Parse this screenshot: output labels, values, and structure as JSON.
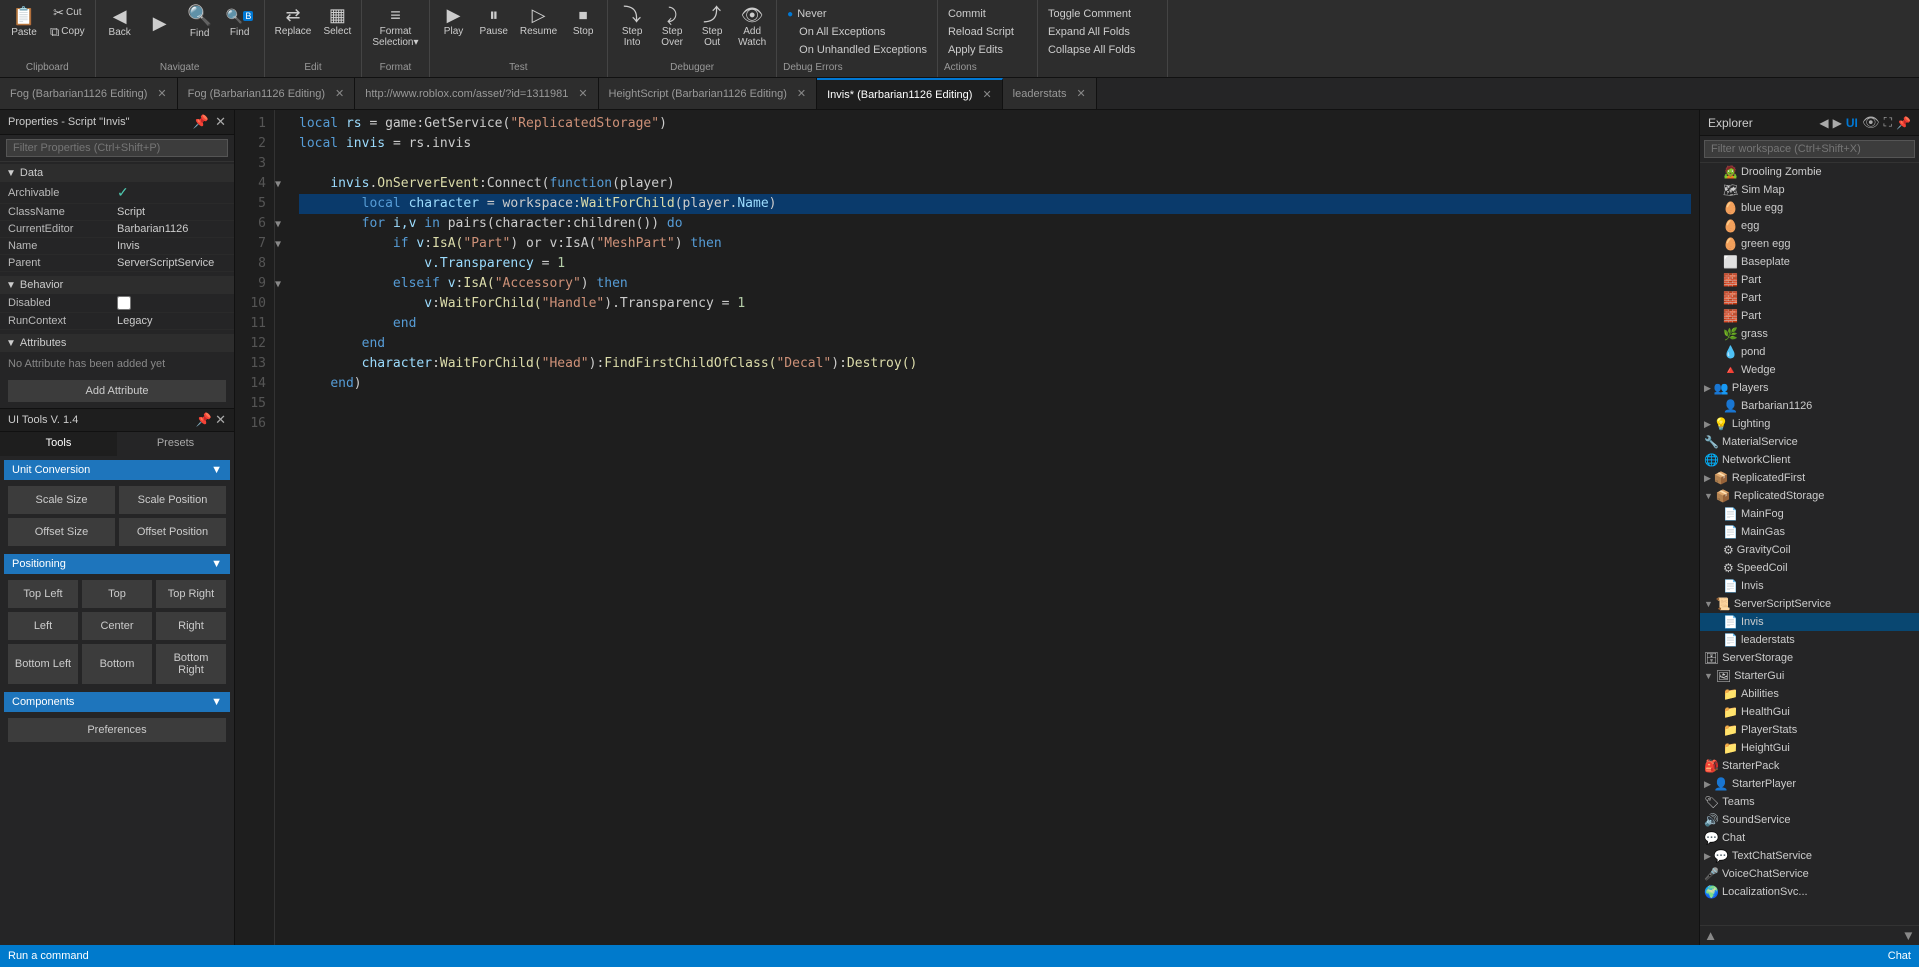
{
  "toolbar": {
    "groups": [
      {
        "label": "Clipboard",
        "buttons": [
          {
            "id": "paste",
            "icon": "📋",
            "label": "Paste"
          },
          {
            "id": "cut",
            "icon": "✂",
            "label": "Cut"
          },
          {
            "id": "copy",
            "icon": "⧉",
            "label": "Copy"
          }
        ]
      },
      {
        "label": "Navigate",
        "buttons": [
          {
            "id": "back",
            "icon": "←",
            "label": "Back"
          },
          {
            "id": "forward",
            "icon": "→",
            "label": ""
          },
          {
            "id": "find",
            "icon": "🔍",
            "label": "Find"
          },
          {
            "id": "find2",
            "icon": "🔍",
            "label": "Find"
          }
        ]
      },
      {
        "label": "Edit",
        "buttons": [
          {
            "id": "replace",
            "icon": "⇄",
            "label": "Replace"
          },
          {
            "id": "select",
            "icon": "▦",
            "label": "Select"
          }
        ]
      },
      {
        "label": "Format",
        "buttons": [
          {
            "id": "format",
            "icon": "≡",
            "label": "Format Selection▾"
          }
        ]
      },
      {
        "label": "Test",
        "buttons": [
          {
            "id": "play",
            "icon": "▶",
            "label": "Play"
          },
          {
            "id": "pause",
            "icon": "⏸",
            "label": "Pause"
          },
          {
            "id": "resume",
            "icon": "▷",
            "label": "Resume"
          },
          {
            "id": "stop",
            "icon": "⏹",
            "label": "Stop"
          }
        ]
      },
      {
        "label": "Debugger",
        "buttons": [
          {
            "id": "stepinto",
            "icon": "⤵",
            "label": "Step Into"
          },
          {
            "id": "stepover",
            "icon": "⤸",
            "label": "Step Over"
          },
          {
            "id": "stepout",
            "icon": "⤴",
            "label": "Step Out"
          },
          {
            "id": "addwatch",
            "icon": "👁",
            "label": "Add Watch"
          }
        ]
      }
    ],
    "menus": {
      "debug_errors": {
        "items": [
          "Never",
          "On All Exceptions",
          "On Unhandled Exceptions"
        ],
        "label": "Debug Errors"
      },
      "actions": {
        "items": [
          "Commit",
          "Reload Script",
          "Apply Edits"
        ],
        "label": "Actions"
      },
      "toggle_actions": {
        "items": [
          "Toggle Comment",
          "Expand All Folds",
          "Collapse All Folds"
        ]
      }
    }
  },
  "tabs": [
    {
      "id": "fog1",
      "label": "Fog (Barbarian1126 Editing)",
      "active": false,
      "closable": true
    },
    {
      "id": "fog2",
      "label": "Fog (Barbarian1126 Editing)",
      "active": false,
      "closable": true
    },
    {
      "id": "url",
      "label": "http://www.roblox.com/asset/?id=1311981",
      "active": false,
      "closable": true
    },
    {
      "id": "heightscript",
      "label": "HeightScript (Barbarian1126 Editing)",
      "active": false,
      "closable": true
    },
    {
      "id": "invis",
      "label": "Invis* (Barbarian1126 Editing)",
      "active": true,
      "closable": true
    },
    {
      "id": "leaderstats",
      "label": "leaderstats",
      "active": false,
      "closable": true
    }
  ],
  "code_editor": {
    "lines": [
      {
        "num": 1,
        "fold": false,
        "highlighted": false,
        "tokens": [
          {
            "t": "local ",
            "c": "kw"
          },
          {
            "t": "rs",
            "c": "var"
          },
          {
            "t": " = game:GetService(",
            "c": "punc"
          },
          {
            "t": "\"ReplicatedStorage\"",
            "c": "str"
          },
          {
            "t": ")",
            "c": "punc"
          }
        ]
      },
      {
        "num": 2,
        "fold": false,
        "highlighted": false,
        "tokens": [
          {
            "t": "local ",
            "c": "kw"
          },
          {
            "t": "invis",
            "c": "var"
          },
          {
            "t": " = rs.invis",
            "c": "punc"
          }
        ]
      },
      {
        "num": 3,
        "fold": false,
        "highlighted": false,
        "tokens": []
      },
      {
        "num": 4,
        "fold": true,
        "highlighted": false,
        "tokens": [
          {
            "t": "    invis.",
            "c": "var"
          },
          {
            "t": "OnServerEvent",
            "c": "fn"
          },
          {
            "t": ":Connect(",
            "c": "punc"
          },
          {
            "t": "function",
            "c": "kw"
          },
          {
            "t": "(player)",
            "c": "punc"
          }
        ]
      },
      {
        "num": 5,
        "fold": false,
        "highlighted": true,
        "tokens": [
          {
            "t": "        ",
            "c": "punc"
          },
          {
            "t": "local ",
            "c": "kw"
          },
          {
            "t": "character",
            "c": "var"
          },
          {
            "t": " = workspace:",
            "c": "punc"
          },
          {
            "t": "WaitForChild",
            "c": "fn"
          },
          {
            "t": "(player.",
            "c": "punc"
          },
          {
            "t": "Name",
            "c": "var"
          },
          {
            "t": ")",
            "c": "punc"
          }
        ]
      },
      {
        "num": 6,
        "fold": true,
        "highlighted": false,
        "tokens": [
          {
            "t": "        ",
            "c": "punc"
          },
          {
            "t": "for ",
            "c": "kw"
          },
          {
            "t": "i,v ",
            "c": "var"
          },
          {
            "t": "in pairs(character:children()) ",
            "c": "punc"
          },
          {
            "t": "do",
            "c": "kw"
          }
        ]
      },
      {
        "num": 7,
        "fold": true,
        "highlighted": false,
        "tokens": [
          {
            "t": "            ",
            "c": "punc"
          },
          {
            "t": "if ",
            "c": "kw"
          },
          {
            "t": "v:IsA(",
            "c": "fn"
          },
          {
            "t": "\"Part\"",
            "c": "str"
          },
          {
            "t": ") or v:IsA(",
            "c": "punc"
          },
          {
            "t": "\"MeshPart\"",
            "c": "str"
          },
          {
            "t": ") ",
            "c": "punc"
          },
          {
            "t": "then",
            "c": "kw"
          }
        ]
      },
      {
        "num": 8,
        "fold": false,
        "highlighted": false,
        "tokens": [
          {
            "t": "                ",
            "c": "punc"
          },
          {
            "t": "v.Transparency",
            "c": "var"
          },
          {
            "t": " = ",
            "c": "punc"
          },
          {
            "t": "1",
            "c": "num"
          }
        ]
      },
      {
        "num": 9,
        "fold": true,
        "highlighted": false,
        "tokens": [
          {
            "t": "            ",
            "c": "punc"
          },
          {
            "t": "elseif ",
            "c": "kw"
          },
          {
            "t": "v:IsA(",
            "c": "fn"
          },
          {
            "t": "\"Accessory\"",
            "c": "str"
          },
          {
            "t": ") ",
            "c": "punc"
          },
          {
            "t": "then",
            "c": "kw"
          }
        ]
      },
      {
        "num": 10,
        "fold": false,
        "highlighted": false,
        "tokens": [
          {
            "t": "                ",
            "c": "punc"
          },
          {
            "t": "v:",
            "c": "var"
          },
          {
            "t": "WaitForChild(",
            "c": "fn"
          },
          {
            "t": "\"Handle\"",
            "c": "str"
          },
          {
            "t": ").Transparency = ",
            "c": "punc"
          },
          {
            "t": "1",
            "c": "num"
          }
        ]
      },
      {
        "num": 11,
        "fold": false,
        "highlighted": false,
        "tokens": [
          {
            "t": "            ",
            "c": "kw"
          },
          {
            "t": "end",
            "c": "kw"
          }
        ]
      },
      {
        "num": 12,
        "fold": false,
        "highlighted": false,
        "tokens": [
          {
            "t": "        ",
            "c": "punc"
          },
          {
            "t": "end",
            "c": "kw"
          }
        ]
      },
      {
        "num": 13,
        "fold": false,
        "highlighted": false,
        "tokens": [
          {
            "t": "        character:",
            "c": "var"
          },
          {
            "t": "WaitForChild(",
            "c": "fn"
          },
          {
            "t": "\"Head\"",
            "c": "str"
          },
          {
            "t": "):FindFirstChildOfClass(",
            "c": "fn"
          },
          {
            "t": "\"Decal\"",
            "c": "str"
          },
          {
            "t": "):Destroy()",
            "c": "fn"
          }
        ]
      },
      {
        "num": 14,
        "fold": false,
        "highlighted": false,
        "tokens": [
          {
            "t": "    ",
            "c": "punc"
          },
          {
            "t": "end",
            "c": "kw"
          },
          {
            "t": ")",
            "c": "punc"
          }
        ]
      },
      {
        "num": 15,
        "fold": false,
        "highlighted": false,
        "tokens": []
      },
      {
        "num": 16,
        "fold": false,
        "highlighted": false,
        "tokens": []
      }
    ]
  },
  "properties_panel": {
    "title": "Properties - Script \"Invis\"",
    "filter_placeholder": "Filter Properties (Ctrl+Shift+P)",
    "sections": {
      "data": {
        "label": "Data",
        "expanded": true,
        "rows": [
          {
            "name": "Archivable",
            "value": "✓",
            "type": "checkbox"
          },
          {
            "name": "ClassName",
            "value": "Script"
          },
          {
            "name": "CurrentEditor",
            "value": "Barbarian1126"
          },
          {
            "name": "Name",
            "value": "Invis"
          },
          {
            "name": "Parent",
            "value": "ServerScriptService"
          }
        ]
      },
      "behavior": {
        "label": "Behavior",
        "expanded": true,
        "rows": [
          {
            "name": "Disabled",
            "value": "",
            "type": "checkbox"
          },
          {
            "name": "RunContext",
            "value": "Legacy"
          }
        ]
      },
      "attributes": {
        "label": "Attributes",
        "expanded": true,
        "rows": [],
        "empty_msg": "No Attribute has been added yet",
        "add_label": "Add Attribute"
      }
    }
  },
  "ui_tools": {
    "title": "UI Tools V. 1.4",
    "tabs": [
      "Tools",
      "Presets"
    ],
    "active_tab": "Tools",
    "unit_conversion": {
      "label": "Unit Conversion",
      "buttons": [
        "Scale Size",
        "Scale Position",
        "Offset Size",
        "Offset Position"
      ]
    },
    "positioning": {
      "label": "Positioning",
      "buttons": [
        [
          "Top Left",
          "Top",
          "Top Right"
        ],
        [
          "Left",
          "Center",
          "Right"
        ],
        [
          "Bottom Left",
          "Bottom",
          "Bottom Right"
        ]
      ]
    },
    "components": {
      "label": "Components"
    },
    "preferences_label": "Preferences"
  },
  "explorer": {
    "title": "Explorer",
    "search_placeholder": "Filter workspace (Ctrl+Shift+X)",
    "view_toggle": [
      "◀",
      "▶",
      "UI",
      "👁"
    ],
    "tree": [
      {
        "label": "Drooling Zombie",
        "indent": 1,
        "icon": "🧟",
        "has_children": false
      },
      {
        "label": "Sim Map",
        "indent": 1,
        "icon": "🗺",
        "has_children": false
      },
      {
        "label": "blue egg",
        "indent": 1,
        "icon": "🥚",
        "has_children": false
      },
      {
        "label": "egg",
        "indent": 1,
        "icon": "🥚",
        "has_children": false
      },
      {
        "label": "green egg",
        "indent": 1,
        "icon": "🥚",
        "has_children": false
      },
      {
        "label": "Baseplate",
        "indent": 1,
        "icon": "⬜",
        "has_children": false
      },
      {
        "label": "Part",
        "indent": 1,
        "icon": "🧱",
        "has_children": false
      },
      {
        "label": "Part",
        "indent": 1,
        "icon": "🧱",
        "has_children": false
      },
      {
        "label": "Part",
        "indent": 1,
        "icon": "🧱",
        "has_children": false
      },
      {
        "label": "grass",
        "indent": 1,
        "icon": "🌿",
        "has_children": false
      },
      {
        "label": "pond",
        "indent": 1,
        "icon": "💧",
        "has_children": false
      },
      {
        "label": "Wedge",
        "indent": 1,
        "icon": "🔺",
        "has_children": false
      },
      {
        "label": "Players",
        "indent": 0,
        "icon": "👥",
        "has_children": true,
        "expanded": true
      },
      {
        "label": "Barbarian1126",
        "indent": 1,
        "icon": "👤",
        "has_children": false
      },
      {
        "label": "Lighting",
        "indent": 0,
        "icon": "💡",
        "has_children": false
      },
      {
        "label": "MaterialService",
        "indent": 0,
        "icon": "🔧",
        "has_children": false
      },
      {
        "label": "NetworkClient",
        "indent": 0,
        "icon": "🌐",
        "has_children": false
      },
      {
        "label": "ReplicatedFirst",
        "indent": 0,
        "icon": "📦",
        "has_children": false
      },
      {
        "label": "ReplicatedStorage",
        "indent": 0,
        "icon": "📦",
        "has_children": true,
        "expanded": true
      },
      {
        "label": "MainFog",
        "indent": 1,
        "icon": "📄",
        "has_children": false
      },
      {
        "label": "MainGas",
        "indent": 1,
        "icon": "📄",
        "has_children": false
      },
      {
        "label": "GravityCoil",
        "indent": 1,
        "icon": "⚙",
        "has_children": false
      },
      {
        "label": "SpeedCoil",
        "indent": 1,
        "icon": "⚙",
        "has_children": false
      },
      {
        "label": "Invis",
        "indent": 1,
        "icon": "📄",
        "has_children": false
      },
      {
        "label": "ServerScriptService",
        "indent": 0,
        "icon": "📜",
        "has_children": true,
        "expanded": true
      },
      {
        "label": "Invis",
        "indent": 1,
        "icon": "📄",
        "has_children": false,
        "selected": true
      },
      {
        "label": "leaderstats",
        "indent": 1,
        "icon": "📄",
        "has_children": false
      },
      {
        "label": "ServerStorage",
        "indent": 0,
        "icon": "🗄",
        "has_children": false
      },
      {
        "label": "StarterGui",
        "indent": 0,
        "icon": "🖼",
        "has_children": true,
        "expanded": true
      },
      {
        "label": "Abilities",
        "indent": 1,
        "icon": "📁",
        "has_children": false
      },
      {
        "label": "HealthGui",
        "indent": 1,
        "icon": "📁",
        "has_children": false
      },
      {
        "label": "PlayerStats",
        "indent": 1,
        "icon": "📁",
        "has_children": false
      },
      {
        "label": "HeightGui",
        "indent": 1,
        "icon": "📁",
        "has_children": false
      },
      {
        "label": "StarterPack",
        "indent": 0,
        "icon": "🎒",
        "has_children": false
      },
      {
        "label": "StarterPlayer",
        "indent": 0,
        "icon": "👤",
        "has_children": false
      },
      {
        "label": "Teams",
        "indent": 0,
        "icon": "🏷",
        "has_children": false
      },
      {
        "label": "SoundService",
        "indent": 0,
        "icon": "🔊",
        "has_children": false
      },
      {
        "label": "Chat",
        "indent": 0,
        "icon": "💬",
        "has_children": false
      },
      {
        "label": "TextChatService",
        "indent": 0,
        "icon": "💬",
        "has_children": false
      },
      {
        "label": "VoiceChatService",
        "indent": 0,
        "icon": "🎤",
        "has_children": false
      },
      {
        "label": "LocalizationSvc...",
        "indent": 0,
        "icon": "🌍",
        "has_children": false
      }
    ]
  },
  "status_bar": {
    "command_label": "Run a command",
    "chat_label": "Chat"
  }
}
